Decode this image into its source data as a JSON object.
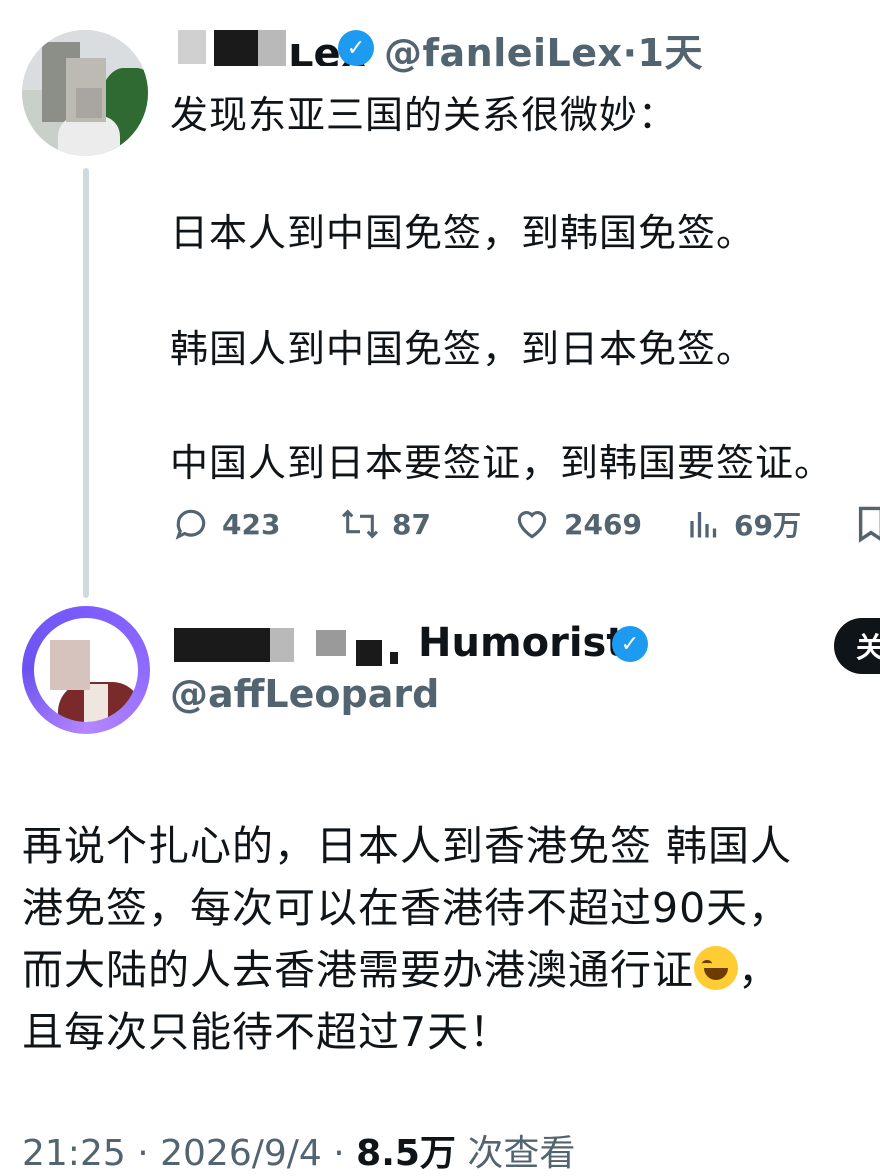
{
  "tweet": {
    "author": {
      "name_visible_fragment": "Lex",
      "handle": "@fanleiLex",
      "separator": "·",
      "age": "1天"
    },
    "lines": [
      "发现东亚三国的关系很微妙：",
      "日本人到中国免签，到韩国免签。",
      "韩国人到中国免签，到日本免签。",
      "中国人到日本要签证，到韩国要签证。"
    ],
    "actions": {
      "replies": "423",
      "retweets": "87",
      "likes": "2469",
      "views": "69万"
    }
  },
  "reply": {
    "author": {
      "name_visible": "Humorist",
      "handle": "@affLeopard"
    },
    "follow_label": "关",
    "lines": [
      "再说个扎心的，日本人到香港免签 韩国人",
      "港免签，每次可以在香港待不超过90天，",
      "而大陆的人去香港需要办港澳通行证",
      "，",
      "且每次只能待不超过7天！"
    ],
    "emoji": "face-with-tears-of-joy",
    "time": "21:25",
    "date": "2026/9/4",
    "view_count": "8.5万",
    "view_label": "次查看",
    "separator": "·"
  },
  "colors": {
    "verified": "#1d9bf0",
    "secondary_text": "#536471",
    "primary_text": "#0f1419",
    "avatar_ring": "#7b5cff"
  }
}
